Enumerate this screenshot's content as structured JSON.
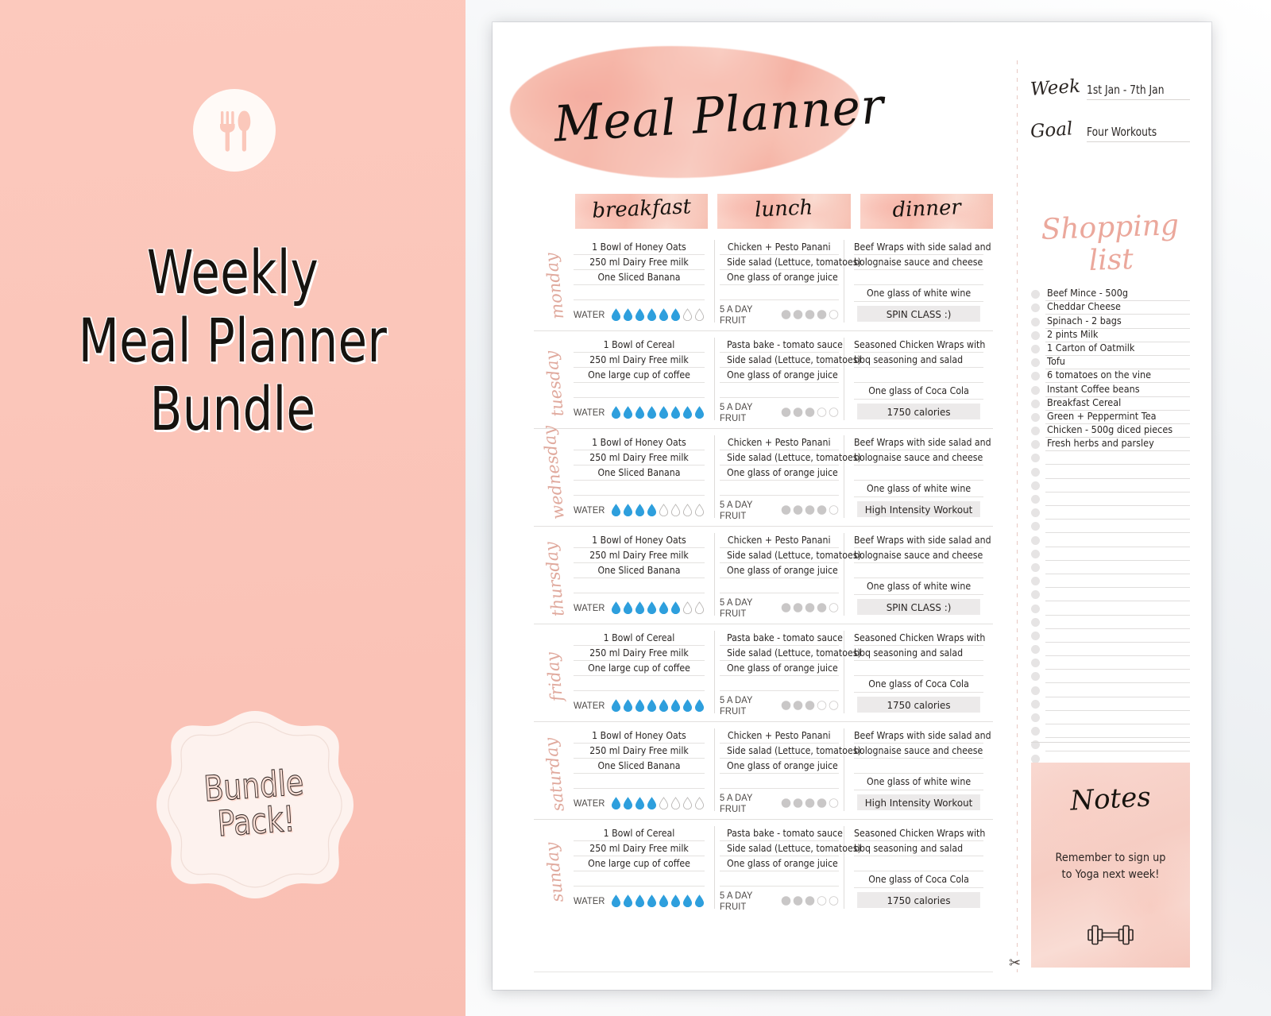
{
  "promo": {
    "icon": "fork-knife-icon",
    "title_lines": [
      "Weekly",
      "Meal Planner",
      "Bundle"
    ],
    "badge_lines": [
      "Bundle",
      "Pack!"
    ],
    "bg_color": "#fbc6ba"
  },
  "planner": {
    "title": "Meal Planner",
    "meta": [
      {
        "label": "Week",
        "value": "1st Jan - 7th Jan"
      },
      {
        "label": "Goal",
        "value": "Four Workouts"
      }
    ],
    "columns": [
      "breakfast",
      "lunch",
      "dinner"
    ],
    "water_label": "WATER",
    "fruit_label": "5 A DAY FRUIT",
    "water_total": 8,
    "fruit_total": 5,
    "days": [
      {
        "name": "monday",
        "breakfast": [
          "1 Bowl of Honey Oats",
          "250 ml Dairy Free milk",
          "One Sliced Banana"
        ],
        "lunch": [
          "Chicken + Pesto Panani",
          "Side salad (Lettuce, tomatoes)",
          "One glass of orange juice"
        ],
        "dinner": [
          "Beef Wraps with side salad and",
          "bolognaise sauce and cheese"
        ],
        "drink": "One glass of white wine",
        "chip": "SPIN CLASS :)",
        "water": 6,
        "fruit": 4
      },
      {
        "name": "tuesday",
        "breakfast": [
          "1 Bowl of Cereal",
          "250 ml Dairy Free milk",
          "One large cup of coffee"
        ],
        "lunch": [
          "Pasta bake - tomato sauce",
          "Side salad (Lettuce, tomatoes)",
          "One glass of orange juice"
        ],
        "dinner": [
          "Seasoned Chicken Wraps with",
          "bbq seasoning and salad"
        ],
        "drink": "One glass of Coca Cola",
        "chip": "1750 calories",
        "water": 8,
        "fruit": 3
      },
      {
        "name": "wednesday",
        "breakfast": [
          "1 Bowl of Honey Oats",
          "250 ml Dairy Free milk",
          "One Sliced Banana"
        ],
        "lunch": [
          "Chicken + Pesto Panani",
          "Side salad (Lettuce, tomatoes)",
          "One glass of orange juice"
        ],
        "dinner": [
          "Beef Wraps with side salad and",
          "bolognaise sauce and cheese"
        ],
        "drink": "One glass of white wine",
        "chip": "High Intensity Workout",
        "water": 4,
        "fruit": 4
      },
      {
        "name": "thursday",
        "breakfast": [
          "1 Bowl of Honey Oats",
          "250 ml Dairy Free milk",
          "One Sliced Banana"
        ],
        "lunch": [
          "Chicken + Pesto Panani",
          "Side salad (Lettuce, tomatoes)",
          "One glass of orange juice"
        ],
        "dinner": [
          "Beef Wraps with side salad and",
          "bolognaise sauce and cheese"
        ],
        "drink": "One glass of white wine",
        "chip": "SPIN CLASS :)",
        "water": 6,
        "fruit": 4
      },
      {
        "name": "friday",
        "breakfast": [
          "1 Bowl of Cereal",
          "250 ml Dairy Free milk",
          "One large cup of coffee"
        ],
        "lunch": [
          "Pasta bake - tomato sauce",
          "Side salad (Lettuce, tomatoes)",
          "One glass of orange juice"
        ],
        "dinner": [
          "Seasoned Chicken Wraps with",
          "bbq seasoning and salad"
        ],
        "drink": "One glass of Coca Cola",
        "chip": "1750 calories",
        "water": 8,
        "fruit": 3
      },
      {
        "name": "saturday",
        "breakfast": [
          "1 Bowl of Honey Oats",
          "250 ml Dairy Free milk",
          "One Sliced Banana"
        ],
        "lunch": [
          "Chicken + Pesto Panani",
          "Side salad (Lettuce, tomatoes)",
          "One glass of orange juice"
        ],
        "dinner": [
          "Beef Wraps with side salad and",
          "bolognaise sauce and cheese"
        ],
        "drink": "One glass of white wine",
        "chip": "High Intensity Workout",
        "water": 4,
        "fruit": 4
      },
      {
        "name": "sunday",
        "breakfast": [
          "1 Bowl of Cereal",
          "250 ml Dairy Free milk",
          "One large cup of coffee"
        ],
        "lunch": [
          "Pasta bake - tomato sauce",
          "Side salad (Lettuce, tomatoes)",
          "One glass of orange juice"
        ],
        "dinner": [
          "Seasoned Chicken Wraps with",
          "bbq seasoning and salad"
        ],
        "drink": "One glass of Coca Cola",
        "chip": "1750 calories",
        "water": 8,
        "fruit": 3
      }
    ],
    "shopping": {
      "title": "Shopping list",
      "items": [
        "Beef Mince - 500g",
        "Cheddar Cheese",
        "Spinach - 2 bags",
        "2 pints Milk",
        "1 Carton of Oatmilk",
        "Tofu",
        "6 tomatoes on the vine",
        "Instant Coffee beans",
        "Breakfast Cereal",
        "Green + Peppermint Tea",
        "Chicken - 500g diced pieces",
        "Fresh herbs and parsley"
      ],
      "blank_rows": 24
    },
    "notes": {
      "title": "Notes",
      "body": "Remember to sign up\nto Yoga next week!",
      "icon": "dumbbell-icon"
    },
    "cut_icon": "scissors-icon"
  },
  "colors": {
    "water_filled": "#2e9fdd",
    "water_empty": "#ffffff",
    "fruit_filled": "#c9c7c7",
    "fruit_empty": "#ffffff",
    "accent_pink": "#f2b4a6",
    "script_pink": "#e0a99d"
  }
}
